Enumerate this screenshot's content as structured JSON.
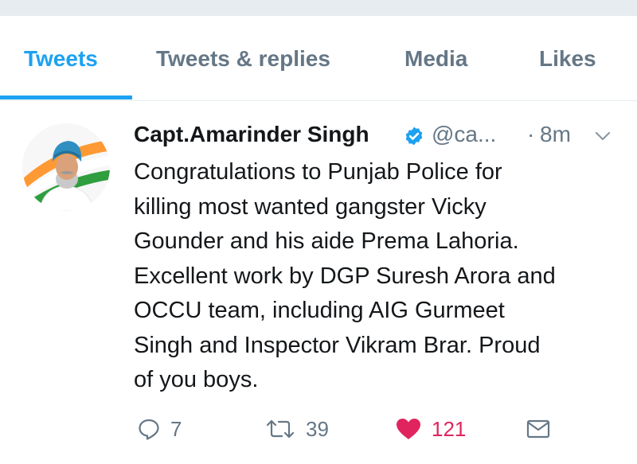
{
  "tabs": [
    {
      "label": "Tweets",
      "active": true
    },
    {
      "label": "Tweets & replies",
      "active": false
    },
    {
      "label": "Media",
      "active": false
    },
    {
      "label": "Likes",
      "active": false
    }
  ],
  "tweet": {
    "author_name": "Capt.Amarinder Singh",
    "handle": "@ca...",
    "separator": "·",
    "time": "8m",
    "text_lines": [
      "Congratulations to Punjab Police for",
      "killing most wanted gangster Vicky",
      "Gounder and his aide Prema Lahoria.",
      "Excellent work by DGP Suresh Arora and",
      "OCCU team, including AIG Gurmeet",
      "Singh and Inspector Vikram Brar. Proud",
      "of you boys."
    ],
    "actions": {
      "reply_count": "7",
      "retweet_count": "39",
      "like_count": "121",
      "liked": true
    }
  },
  "icons": {
    "verified": "verified-badge-icon",
    "chevron": "chevron-down-icon",
    "reply": "reply-icon",
    "retweet": "retweet-icon",
    "like": "heart-icon",
    "dm": "envelope-icon"
  },
  "colors": {
    "accent": "#1da1f2",
    "like": "#e0245e",
    "muted": "#657786",
    "text": "#14171a",
    "divider": "#e6ecf0"
  }
}
